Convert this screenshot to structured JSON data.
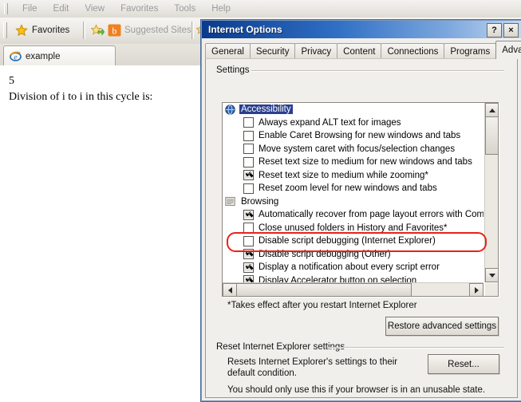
{
  "browser": {
    "menu": [
      "File",
      "Edit",
      "View",
      "Favorites",
      "Tools",
      "Help"
    ],
    "favorites_button_label": "Favorites",
    "suggested_sites_label": "Suggested Sites",
    "tab_label": "example",
    "page_lines": [
      "5",
      "Division of i to i in this cycle is:"
    ]
  },
  "dialog": {
    "title": "Internet Options",
    "help_button": "?",
    "close_button": "×",
    "tabs": [
      {
        "label": "General",
        "active": false
      },
      {
        "label": "Security",
        "active": false
      },
      {
        "label": "Privacy",
        "active": false
      },
      {
        "label": "Content",
        "active": false
      },
      {
        "label": "Connections",
        "active": false
      },
      {
        "label": "Programs",
        "active": false
      },
      {
        "label": "Advanced",
        "active": true
      }
    ],
    "settings_group_label": "Settings",
    "settings_list": [
      {
        "type": "category",
        "label": "Accessibility",
        "selected": true,
        "icon": "accessibility-icon"
      },
      {
        "type": "option",
        "label": "Always expand ALT text for images",
        "checked": false
      },
      {
        "type": "option",
        "label": "Enable Caret Browsing for new windows and tabs",
        "checked": false
      },
      {
        "type": "option",
        "label": "Move system caret with focus/selection changes",
        "checked": false
      },
      {
        "type": "option",
        "label": "Reset text size to medium for new windows and tabs",
        "checked": false
      },
      {
        "type": "option",
        "label": "Reset text size to medium while zooming*",
        "checked": true
      },
      {
        "type": "option",
        "label": "Reset zoom level for new windows and tabs",
        "checked": false
      },
      {
        "type": "category",
        "label": "Browsing",
        "selected": false,
        "icon": "browsing-icon"
      },
      {
        "type": "option",
        "label": "Automatically recover from page layout errors with Compa",
        "checked": true
      },
      {
        "type": "option",
        "label": "Close unused folders in History and Favorites*",
        "checked": false
      },
      {
        "type": "option",
        "label": "Disable script debugging (Internet Explorer)",
        "checked": false,
        "highlighted": true
      },
      {
        "type": "option",
        "label": "Disable script debugging (Other)",
        "checked": true
      },
      {
        "type": "option",
        "label": "Display a notification about every script error",
        "checked": true
      },
      {
        "type": "option",
        "label": "Display Accelerator button on selection",
        "checked": true
      }
    ],
    "restart_note": "*Takes effect after you restart Internet Explorer",
    "restore_button_label": "Restore advanced settings",
    "reset_group_label": "Reset Internet Explorer settings",
    "reset_description": "Resets Internet Explorer's settings to their default condition.",
    "reset_button_label": "Reset...",
    "reset_warning": "You should only use this if your browser is in an unusable state."
  },
  "colors": {
    "title_bar_start": "#0a3a8c",
    "title_bar_end": "#c2d7f0",
    "highlight_red": "#e8221b",
    "selection_blue": "#2a3f8f",
    "dialog_face": "#f1efeb"
  }
}
